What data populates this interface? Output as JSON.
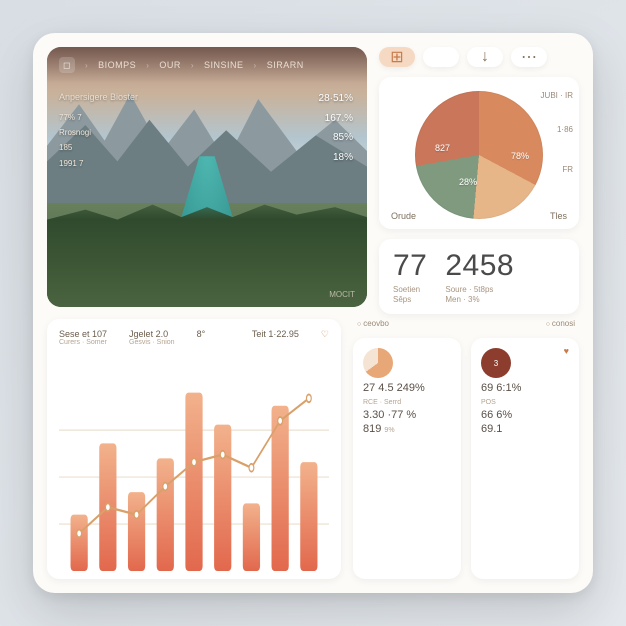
{
  "hero": {
    "nav": [
      "BIOMPS",
      "OUR",
      "SINSINE",
      "SIRARN"
    ],
    "overlay_title": "Anpersigere Bioster",
    "left_rows": [
      {
        "a": "77%",
        "b": "7"
      },
      {
        "a": "Rrosnogi",
        "b": ""
      },
      {
        "a": "185",
        "b": ""
      },
      {
        "a": "1991",
        "b": "7"
      }
    ],
    "right_rows": [
      {
        "v": "28·51%"
      },
      {
        "v": "167.%"
      },
      {
        "v": "85%"
      },
      {
        "v": "18%"
      }
    ],
    "foot": "MOCIT"
  },
  "pills": {
    "grid_icon": "⊞",
    "down_icon": "↓",
    "more_icon": "⋯"
  },
  "pie": {
    "center_a": "827",
    "center_b": "28%",
    "right_a": "78%",
    "side_labels": [
      "JUBI · IR",
      "1·86",
      "FR"
    ],
    "legend_left": "Orude",
    "legend_right": "Tles"
  },
  "kpi": {
    "a": "77",
    "a_sub1": "Soetien",
    "a_sub2": "Sêps",
    "b": "2458",
    "b_sub1": "Soure · 5t8ps",
    "b_sub2": "Men · 3%"
  },
  "chart_data": {
    "type": "bar+line",
    "header": [
      {
        "t": "Sese et 107",
        "s": "Curers · Somer"
      },
      {
        "t": "Jgelet 2.0",
        "s": "Gesvis · Snion"
      },
      {
        "t": "8°",
        "s": ""
      },
      {
        "t": "Teit 1·22.95",
        "s": ""
      }
    ],
    "categories": [
      "",
      "",
      "",
      "",
      "",
      "",
      "",
      "",
      ""
    ],
    "bars": [
      30,
      68,
      42,
      60,
      95,
      78,
      36,
      88,
      58
    ],
    "line": [
      20,
      34,
      30,
      45,
      58,
      62,
      55,
      80,
      92
    ],
    "ylim": [
      0,
      100
    ],
    "bar_color_top": "#f2b28c",
    "bar_color_bot": "#e2684d",
    "line_color": "#d9a06a"
  },
  "metrics": {
    "head_left": "ceovbo",
    "head_right": "conosi",
    "cardA": {
      "ring_pct": 65,
      "ring_color": "#f0c8a8",
      "l1": "27 4.5 249%",
      "l1b": "RCE · Serrd",
      "l2": "3.30 ·77 %",
      "l3": "819",
      "l3b": "9%"
    },
    "cardB": {
      "ring_pct": 100,
      "ring_color": "#8c3d2e",
      "ring_text": "3",
      "l1": "69 6:1%",
      "l1b": "POS",
      "l2": "66 6%",
      "l3": "69.1"
    }
  }
}
